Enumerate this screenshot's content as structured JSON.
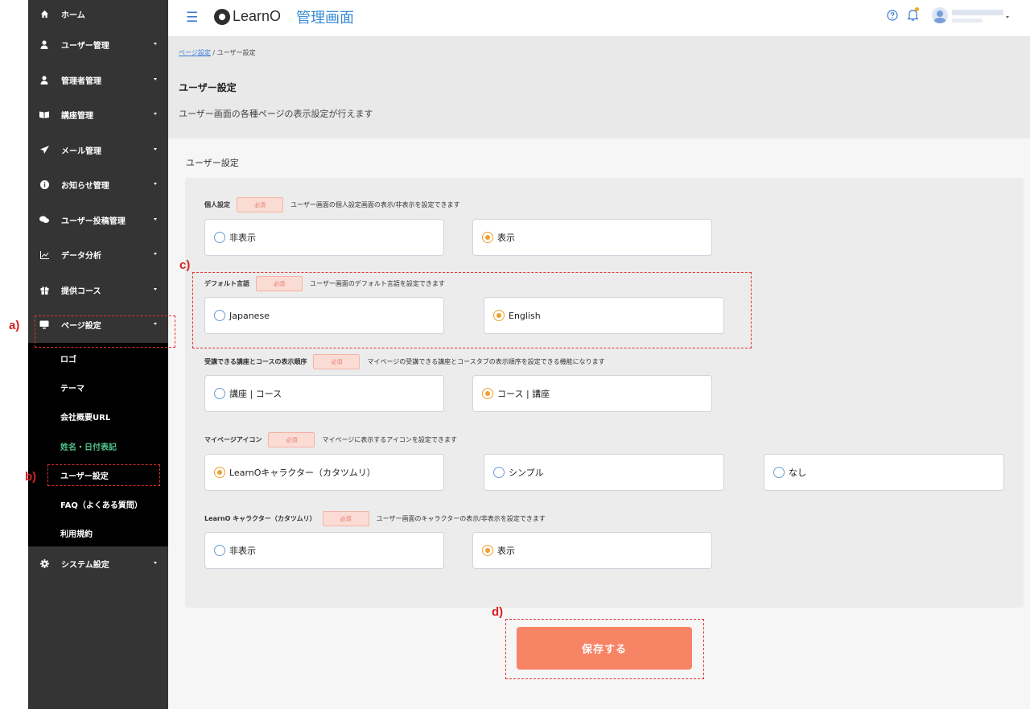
{
  "sidebar": {
    "items": [
      {
        "label": "ホーム",
        "icon": "home-icon"
      },
      {
        "label": "ユーザー管理",
        "icon": "user-icon"
      },
      {
        "label": "管理者管理",
        "icon": "user-icon"
      },
      {
        "label": "講座管理",
        "icon": "book-icon"
      },
      {
        "label": "メール管理",
        "icon": "send-icon"
      },
      {
        "label": "お知らせ管理",
        "icon": "info-icon"
      },
      {
        "label": "ユーザー投稿管理",
        "icon": "chat-icon"
      },
      {
        "label": "データ分析",
        "icon": "chart-icon"
      },
      {
        "label": "提供コース",
        "icon": "gift-icon"
      },
      {
        "label": "ページ設定",
        "icon": "monitor-icon"
      },
      {
        "label": "システム設定",
        "icon": "gear-icon"
      }
    ],
    "submenu": [
      {
        "label": "ロゴ"
      },
      {
        "label": "テーマ"
      },
      {
        "label": "会社概要URL"
      },
      {
        "label": "姓名・日付表記"
      },
      {
        "label": "ユーザー設定"
      },
      {
        "label": "FAQ（よくある質問）"
      },
      {
        "label": "利用規約"
      }
    ]
  },
  "header": {
    "logo_text": "LearnO",
    "admin_title": "管理画面"
  },
  "breadcrumb": {
    "link": "ページ設定",
    "separator": " / ",
    "current": "ユーザー設定"
  },
  "page": {
    "title": "ユーザー設定",
    "description": "ユーザー画面の各種ページの表示設定が行えます"
  },
  "section_title": "ユーザー設定",
  "required_label": "必須",
  "settings": [
    {
      "label": "個人設定",
      "desc": "ユーザー画面の個人設定画面の表示/非表示を設定できます",
      "options": [
        "非表示",
        "表示"
      ],
      "selected": 1
    },
    {
      "label": "デフォルト言語",
      "desc": "ユーザー画面のデフォルト言語を設定できます",
      "options": [
        "Japanese",
        "English"
      ],
      "selected": 1
    },
    {
      "label": "受講できる講座とコースの表示順序",
      "desc": "マイページの受講できる講座とコースタブの表示順序を設定できる機能になります",
      "options": [
        "講座 | コース",
        "コース | 講座"
      ],
      "selected": 1
    },
    {
      "label": "マイページアイコン",
      "desc": "マイページに表示するアイコンを設定できます",
      "options": [
        "LearnOキャラクター（カタツムリ）",
        "シンプル",
        "なし"
      ],
      "selected": 0
    },
    {
      "label": "LearnO キャラクター（カタツムリ）",
      "desc": "ユーザー画面のキャラクターの表示/非表示を設定できます",
      "options": [
        "非表示",
        "表示"
      ],
      "selected": 1
    }
  ],
  "save_label": "保存する",
  "annotations": {
    "a": "a)",
    "b": "b)",
    "c": "c)",
    "d": "d)"
  },
  "colors": {
    "accent": "#f88466",
    "radio_on": "#f0a030",
    "link": "#3a7bd5",
    "active_menu": "#4fc38d",
    "annotation": "#e53030"
  }
}
